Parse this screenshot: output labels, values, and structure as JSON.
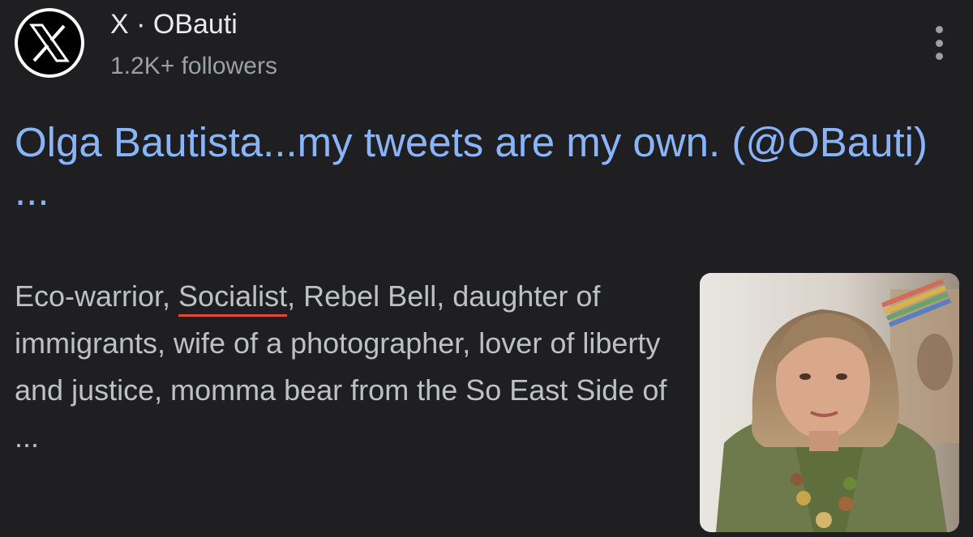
{
  "source": {
    "logo_icon": "x-logo-icon",
    "name": "X · OBauti",
    "followers": "1.2K+ followers"
  },
  "result": {
    "title": "Olga Bautista...my tweets are my own. (@OBauti) ...",
    "snippet_before": "Eco-warrior, ",
    "snippet_flagged": "Socialist",
    "snippet_after": ", Rebel Bell, daughter of immigrants, wife of a photographer, lover of liberty and justice, momma bear from the So East Side of ..."
  },
  "colors": {
    "background": "#1f1f21",
    "title_link": "#8ab4f8",
    "body_text": "#bdc1c6",
    "muted": "#9aa0a6",
    "highlight_underline": "#e8453c"
  }
}
